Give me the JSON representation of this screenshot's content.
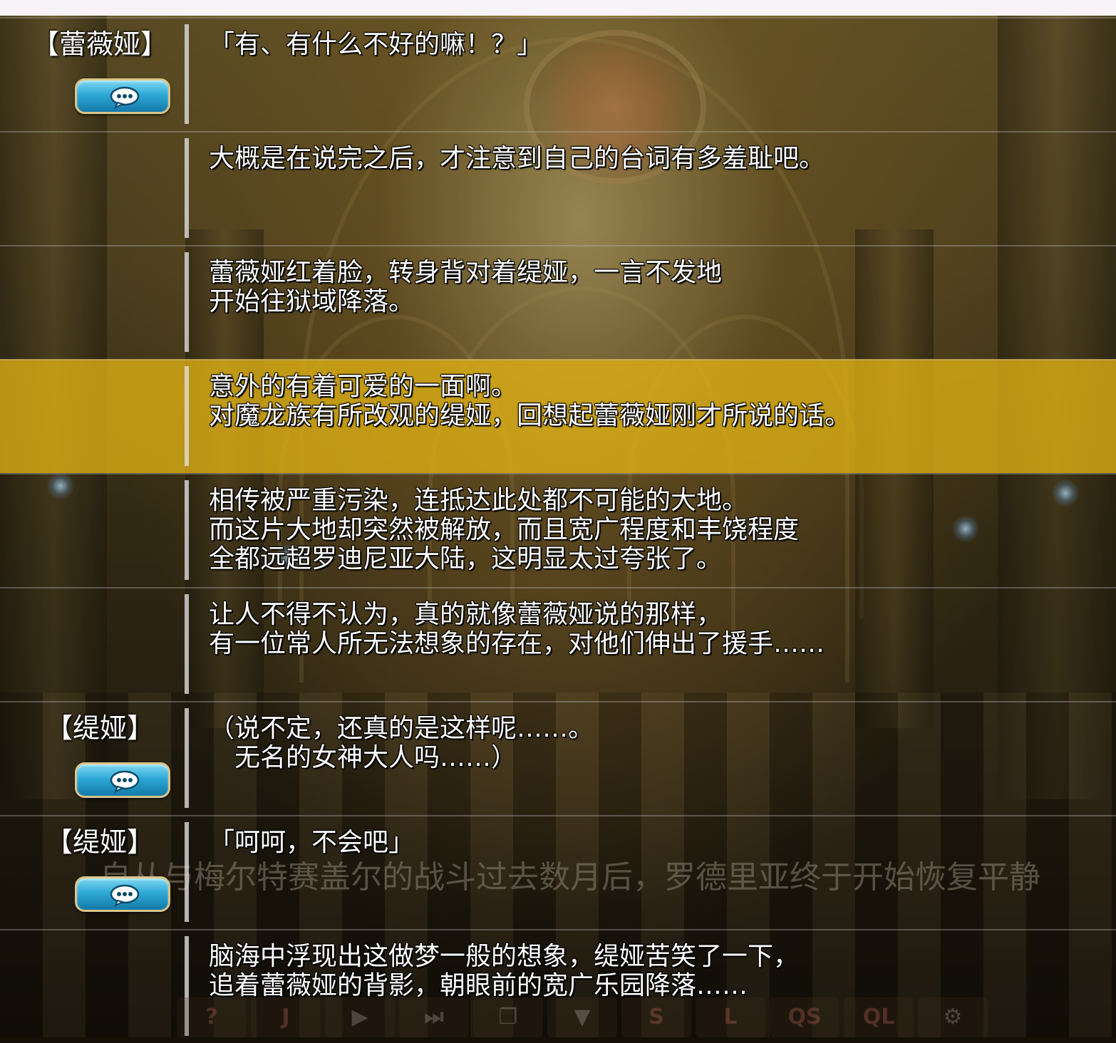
{
  "log_entries": [
    {
      "speaker": "【蕾薇娅】",
      "has_voice": true,
      "text": "「有、有什么不好的嘛！？」",
      "highlight": false
    },
    {
      "speaker": "",
      "has_voice": false,
      "text": "大概是在说完之后，才注意到自己的台词有多羞耻吧。",
      "highlight": false
    },
    {
      "speaker": "",
      "has_voice": false,
      "text": "蕾薇娅红着脸，转身背对着缇娅，一言不发地\n开始往狱域降落。",
      "highlight": false
    },
    {
      "speaker": "",
      "has_voice": false,
      "text": "意外的有着可爱的一面啊。\n对魔龙族有所改观的缇娅，回想起蕾薇娅刚才所说的话。",
      "highlight": true
    },
    {
      "speaker": "",
      "has_voice": false,
      "text": "相传被严重污染，连抵达此处都不可能的大地。\n而这片大地却突然被解放，而且宽广程度和丰饶程度\n全都远超罗迪尼亚大陆，这明显太过夸张了。",
      "highlight": false
    },
    {
      "speaker": "",
      "has_voice": false,
      "text": "让人不得不认为，真的就像蕾薇娅说的那样，\n有一位常人所无法想象的存在，对他们伸出了援手……",
      "highlight": false
    },
    {
      "speaker": "【缇娅】",
      "has_voice": true,
      "text": "（说不定，还真的是这样呢……。\n　无名的女神大人吗……）",
      "highlight": false
    },
    {
      "speaker": "【缇娅】",
      "has_voice": true,
      "text": "「呵呵，不会吧」",
      "highlight": false
    },
    {
      "speaker": "",
      "has_voice": false,
      "text": "脑海中浮现出这做梦一般的想象，缇娅苦笑了一下，\n追着蕾薇娅的背影，朝眼前的宽广乐园降落……",
      "highlight": false
    }
  ],
  "ghost_caption": "自从与梅尔特赛盖尔的战斗过去数月后，罗德里亚终于开始恢复平静",
  "voice_icon": "speech-bubble-icon",
  "quickbar": [
    {
      "label": "?",
      "icon": "help-icon"
    },
    {
      "label": "J",
      "icon": "jump-icon"
    },
    {
      "label": "",
      "icon": "play-icon"
    },
    {
      "label": "",
      "icon": "skip-icon"
    },
    {
      "label": "",
      "icon": "copy-icon"
    },
    {
      "label": "",
      "icon": "chevron-down-icon"
    },
    {
      "label": "S",
      "icon": "save-icon"
    },
    {
      "label": "L",
      "icon": "load-icon"
    },
    {
      "label": "QS",
      "icon": "quicksave-icon"
    },
    {
      "label": "QL",
      "icon": "quickload-icon"
    },
    {
      "label": "",
      "icon": "gear-icon"
    }
  ],
  "colors": {
    "highlight": "#d6aa14",
    "voice_button": "#2fa8d6",
    "button_border": "#d8c488"
  }
}
